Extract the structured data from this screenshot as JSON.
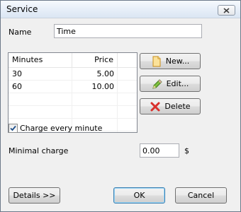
{
  "window": {
    "title": "Service"
  },
  "name_field": {
    "label": "Name",
    "value": "Time"
  },
  "prices_table": {
    "columns": [
      "Minutes",
      "Price"
    ],
    "rows": [
      {
        "minutes": "30",
        "price": "5.00"
      },
      {
        "minutes": "60",
        "price": "10.00"
      }
    ]
  },
  "actions": {
    "new_label": "New...",
    "edit_label": "Edit...",
    "delete_label": "Delete"
  },
  "charge_every_minute": {
    "label": "Charge every minute",
    "checked": true
  },
  "minimal_charge": {
    "label": "Minimal charge",
    "value": "0.00",
    "currency": "$"
  },
  "footer": {
    "details_label": "Details >>",
    "ok_label": "OK",
    "cancel_label": "Cancel"
  },
  "colors": {
    "title_bar": "#dbe6f3",
    "default_button_border": "#3c7fb1",
    "delete_icon": "#d9302c"
  }
}
